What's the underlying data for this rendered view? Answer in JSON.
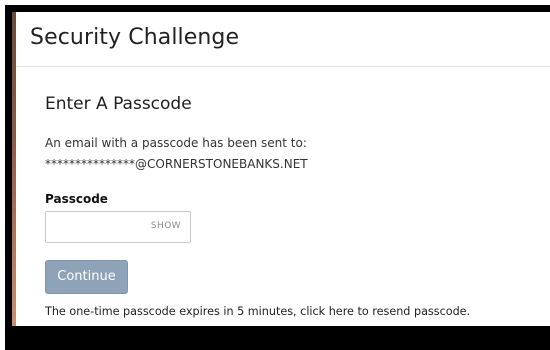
{
  "page": {
    "title": "Security Challenge"
  },
  "challenge": {
    "heading": "Enter A Passcode",
    "info_line_1": "An email with a passcode has been sent to:",
    "masked_email": "***************@CORNERSTONEBANKS.NET",
    "passcode_label": "Passcode",
    "passcode_value": "",
    "show_label": "SHOW",
    "continue_label": "Continue",
    "expiry_text": "The one-time passcode expires in 5 minutes, click here to resend passcode."
  },
  "colors": {
    "continue_button": "#8ea2b8",
    "accent_bar": "#8c5a4a",
    "frame": "#000000"
  }
}
